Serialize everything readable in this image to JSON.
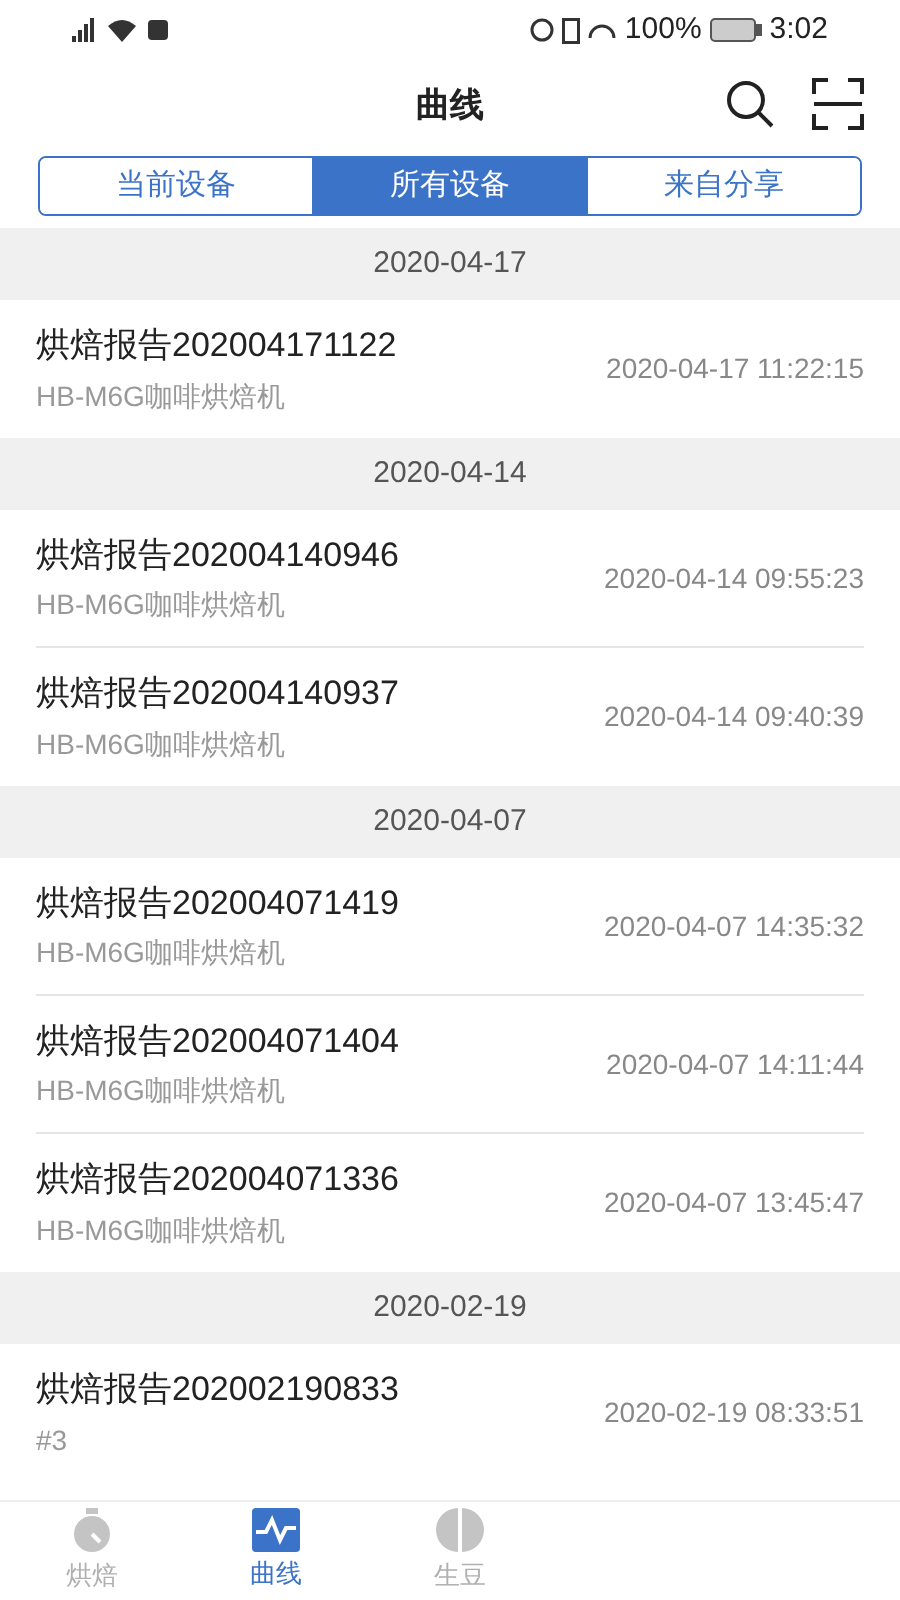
{
  "status_bar": {
    "battery": "100%",
    "time": "3:02"
  },
  "header": {
    "title": "曲线"
  },
  "tabs": [
    {
      "label": "当前设备",
      "selected": false
    },
    {
      "label": "所有设备",
      "selected": true
    },
    {
      "label": "来自分享",
      "selected": false
    }
  ],
  "groups": [
    {
      "date": "2020-04-17",
      "items": [
        {
          "title": "烘焙报告202004171122",
          "subtitle": "HB-M6G咖啡烘焙机",
          "time": "2020-04-17 11:22:15"
        }
      ]
    },
    {
      "date": "2020-04-14",
      "items": [
        {
          "title": "烘焙报告202004140946",
          "subtitle": "HB-M6G咖啡烘焙机",
          "time": "2020-04-14 09:55:23"
        },
        {
          "title": "烘焙报告202004140937",
          "subtitle": "HB-M6G咖啡烘焙机",
          "time": "2020-04-14 09:40:39"
        }
      ]
    },
    {
      "date": "2020-04-07",
      "items": [
        {
          "title": "烘焙报告202004071419",
          "subtitle": "HB-M6G咖啡烘焙机",
          "time": "2020-04-07 14:35:32"
        },
        {
          "title": "烘焙报告202004071404",
          "subtitle": "HB-M6G咖啡烘焙机",
          "time": "2020-04-07 14:11:44"
        },
        {
          "title": "烘焙报告202004071336",
          "subtitle": "HB-M6G咖啡烘焙机",
          "time": "2020-04-07 13:45:47"
        }
      ]
    },
    {
      "date": "2020-02-19",
      "items": [
        {
          "title": "烘焙报告202002190833",
          "subtitle": "#3",
          "time": "2020-02-19 08:33:51"
        }
      ]
    }
  ],
  "bottom_nav": [
    {
      "kind": "timer",
      "label": "烘焙",
      "selected": false
    },
    {
      "kind": "curve",
      "label": "曲线",
      "selected": true
    },
    {
      "kind": "bean",
      "label": "生豆",
      "selected": false
    }
  ]
}
